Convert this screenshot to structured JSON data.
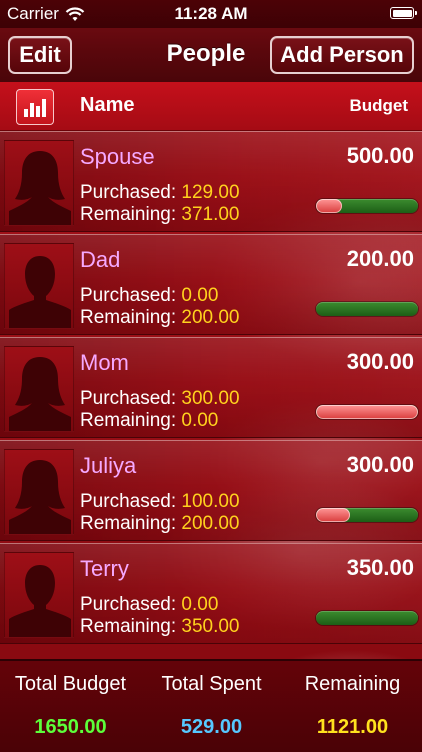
{
  "status_bar": {
    "carrier": "Carrier",
    "time": "11:28 AM"
  },
  "nav": {
    "edit_label": "Edit",
    "title": "People",
    "add_label": "Add Person"
  },
  "list_header": {
    "chart_icon": "bar-chart-icon",
    "name_label": "Name",
    "budget_label": "Budget"
  },
  "labels": {
    "purchased": "Purchased:",
    "remaining": "Remaining:"
  },
  "people": [
    {
      "name": "Spouse",
      "avatar": "female-silhouette",
      "budget": "500.00",
      "purchased": "129.00",
      "remaining": "371.00",
      "spent_fraction": 0.258
    },
    {
      "name": "Dad",
      "avatar": "male-silhouette",
      "budget": "200.00",
      "purchased": "0.00",
      "remaining": "200.00",
      "spent_fraction": 0.0
    },
    {
      "name": "Mom",
      "avatar": "female-silhouette",
      "budget": "300.00",
      "purchased": "300.00",
      "remaining": "0.00",
      "spent_fraction": 1.0
    },
    {
      "name": "Juliya",
      "avatar": "female-silhouette",
      "budget": "300.00",
      "purchased": "100.00",
      "remaining": "200.00",
      "spent_fraction": 0.333
    },
    {
      "name": "Terry",
      "avatar": "male-silhouette",
      "budget": "350.00",
      "purchased": "0.00",
      "remaining": "350.00",
      "spent_fraction": 0.0
    }
  ],
  "footer": {
    "total_budget_label": "Total Budget",
    "total_budget": "1650.00",
    "total_spent_label": "Total Spent",
    "total_spent": "529.00",
    "remaining_label": "Remaining",
    "remaining": "1121.00"
  },
  "colors": {
    "name": "#f5a9ff",
    "value": "#ffd21e",
    "budget_total": "#5cff3a",
    "spent_total": "#56c8ff",
    "remaining_total": "#ffe21e"
  }
}
